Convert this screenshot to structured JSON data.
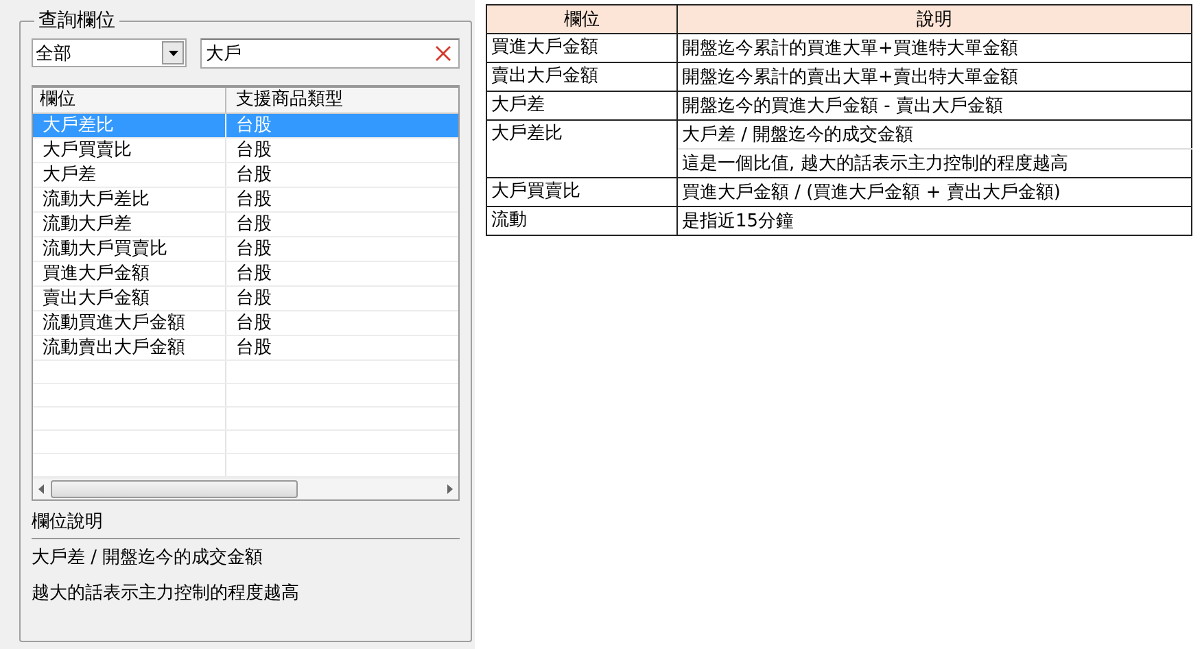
{
  "query_panel": {
    "title": "查詢欄位",
    "category_dropdown": {
      "value": "全部"
    },
    "search_field": {
      "value": "大戶"
    },
    "field_list": {
      "columns": [
        "欄位",
        "支援商品類型"
      ],
      "rows": [
        {
          "field": "大戶差比",
          "type": "台股",
          "selected": true
        },
        {
          "field": "大戶買賣比",
          "type": "台股",
          "selected": false
        },
        {
          "field": "大戶差",
          "type": "台股",
          "selected": false
        },
        {
          "field": "流動大戶差比",
          "type": "台股",
          "selected": false
        },
        {
          "field": "流動大戶差",
          "type": "台股",
          "selected": false
        },
        {
          "field": "流動大戶買賣比",
          "type": "台股",
          "selected": false
        },
        {
          "field": "買進大戶金額",
          "type": "台股",
          "selected": false
        },
        {
          "field": "賣出大戶金額",
          "type": "台股",
          "selected": false
        },
        {
          "field": "流動買進大戶金額",
          "type": "台股",
          "selected": false
        },
        {
          "field": "流動賣出大戶金額",
          "type": "台股",
          "selected": false
        }
      ]
    },
    "description_title": "欄位說明",
    "description_lines": [
      "大戶差 / 開盤迄今的成交金額",
      "越大的話表示主力控制的程度越高"
    ]
  },
  "reference_table": {
    "columns": [
      "欄位",
      "說明"
    ],
    "rows": [
      {
        "field": "買進大戶金額",
        "descriptions": [
          "開盤迄今累計的買進大單+買進特大單金額"
        ]
      },
      {
        "field": "賣出大戶金額",
        "descriptions": [
          "開盤迄今累計的賣出大單+賣出特大單金額"
        ]
      },
      {
        "field": "大戶差",
        "descriptions": [
          "開盤迄今的買進大戶金額 - 賣出大戶金額"
        ]
      },
      {
        "field": "大戶差比",
        "descriptions": [
          "大戶差 / 開盤迄今的成交金額",
          "這是一個比值, 越大的話表示主力控制的程度越高"
        ]
      },
      {
        "field": "大戶買賣比",
        "descriptions": [
          "買進大戶金額 / (買進大戶金額 + 賣出大戶金額)"
        ]
      },
      {
        "field": "流動",
        "descriptions": [
          "是指近15分鐘"
        ]
      }
    ]
  }
}
